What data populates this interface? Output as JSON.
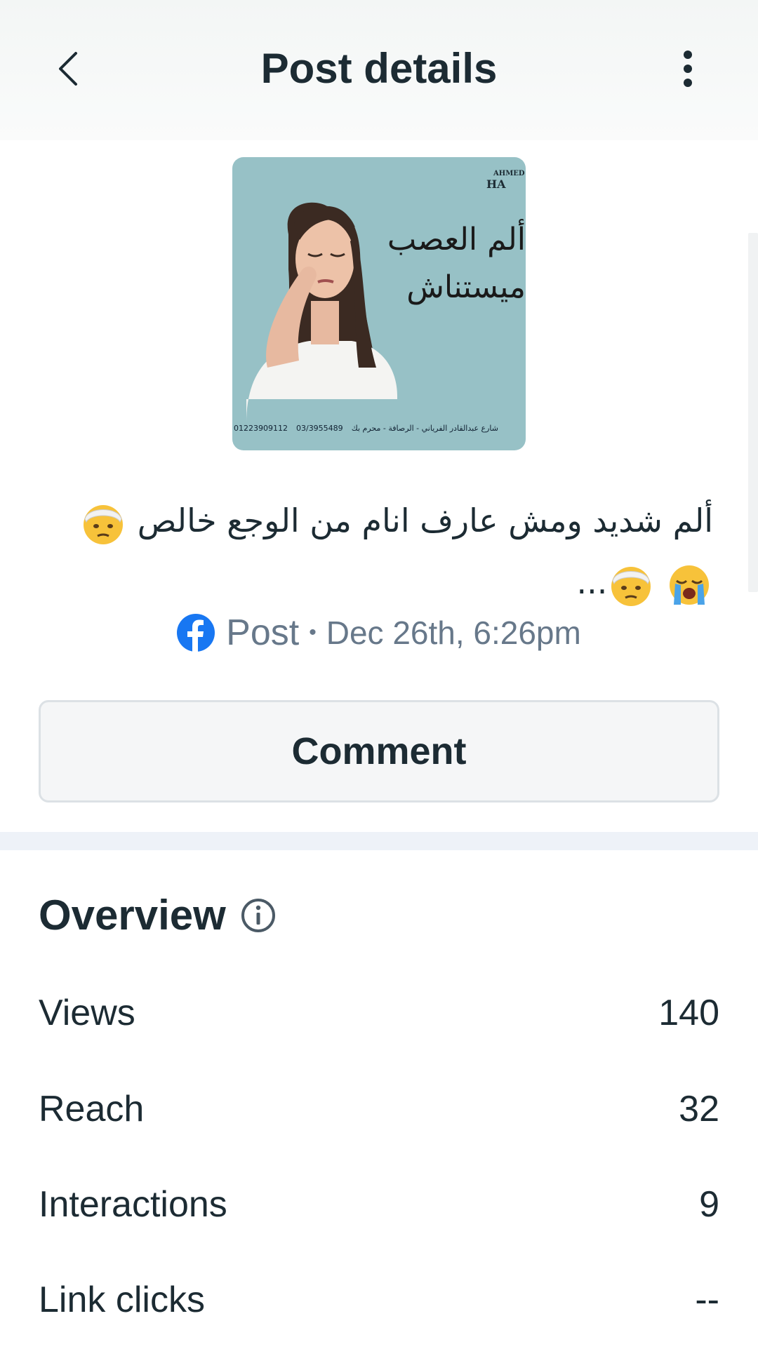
{
  "header": {
    "title": "Post details",
    "back_icon": "chevron-left-icon",
    "menu_icon": "more-vertical-icon"
  },
  "post": {
    "image": {
      "brand_line1": "AHMED",
      "brand_line2": "HA",
      "ad_text_line1": "ألم العصب",
      "ad_text_line2": "ميستناش",
      "footer_phone1": "01223909112",
      "footer_phone2": "03/3955489",
      "footer_address": "شارع عبدالقادر الفرياني - الرصافة - محرم بك"
    },
    "caption_line1": "ألم  شديد ومش عارف انام من الوجع خالص",
    "caption_line2_suffix": "...",
    "platform_icon": "facebook-icon",
    "type": "Post",
    "separator": "•",
    "date": "Dec 26th, 6:26pm"
  },
  "comment_button": {
    "label": "Comment"
  },
  "overview": {
    "title": "Overview",
    "info_icon": "info-icon",
    "stats": [
      {
        "label": "Views",
        "value": "140"
      },
      {
        "label": "Reach",
        "value": "32"
      },
      {
        "label": "Interactions",
        "value": "9"
      },
      {
        "label": "Link clicks",
        "value": "--"
      }
    ]
  },
  "colors": {
    "text_primary": "#1c2b33",
    "text_secondary": "#67788a",
    "facebook_blue": "#1877f2",
    "divider": "#eef2f8",
    "button_border": "#dce1e5"
  }
}
